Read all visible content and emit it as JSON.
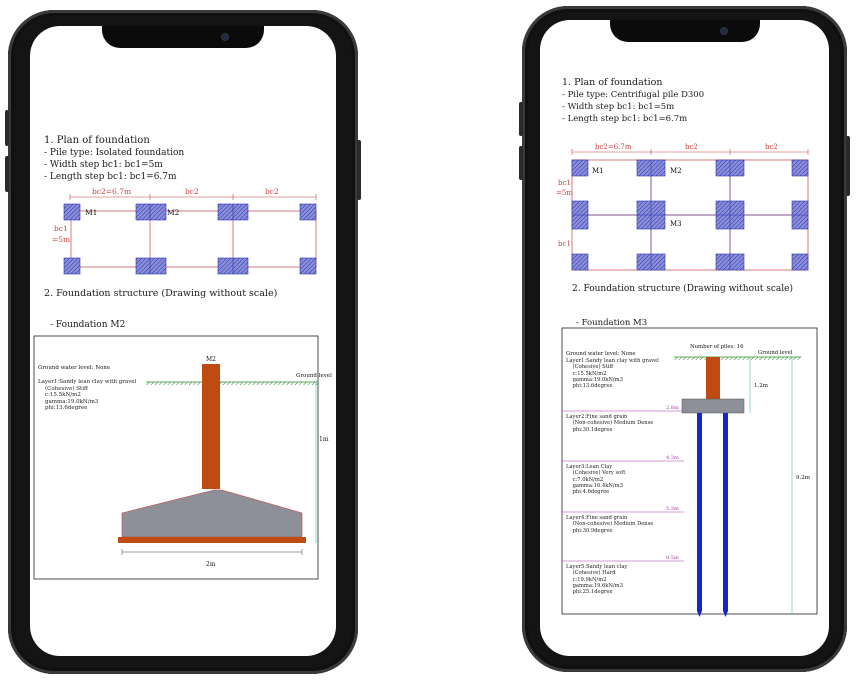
{
  "left": {
    "plan": {
      "heading": "1. Plan of foundation",
      "pile_type": "- Pile type: Isolated foundation",
      "width_step": "- Width step bc1: bc1=5m",
      "length_step": "- Length step bc1: bc1=6.7m",
      "dim_top": [
        "bc2=6.7m",
        "bc2",
        "bc2"
      ],
      "dim_side": [
        "bc1",
        "=5m"
      ],
      "marks": [
        "M1",
        "M2"
      ]
    },
    "structure_heading": "2. Foundation structure (Drawing without scale)",
    "foundation_label": "- Foundation M2",
    "section": {
      "column_label": "M2",
      "ground_water": "Ground water level: None",
      "ground_level": "Ground level",
      "layer1": "Layer1:Sandy lean clay with gravel\n    (Cohesive) Stiff\n    c:15.5kN/m2\n    gamma:19.0kN/m3\n    phi:13.6degree",
      "depth": "1m",
      "width": "2m"
    }
  },
  "right": {
    "plan": {
      "heading": "1. Plan of foundation",
      "pile_type": "- Pile type: Centrifugal pile D300",
      "width_step": "- Width step bc1: bc1=5m",
      "length_step": "- Length step bc1: bc1=6.7m",
      "dim_top": [
        "bc2=6.7m",
        "bc2",
        "bc2"
      ],
      "dim_side": [
        "bc1",
        "=5m",
        "bc1"
      ],
      "marks": [
        "M1",
        "M2",
        "M3"
      ]
    },
    "structure_heading": "2. Foundation structure (Drawing without scale)",
    "foundation_label": "- Foundation M3",
    "section": {
      "piles_count": "Number of piles: 16",
      "ground_water": "Ground water level: None",
      "ground_level": "Ground level",
      "depth_cap": "1.2m",
      "depth_pile": "9.2m",
      "layers": [
        {
          "text": "Layer1:Sandy lean clay with gravel\n    (Cohesive) Stiff\n    c:15.5kN/m2\n    gamma:19.0kN/m3\n    phi:13.6degree",
          "depth": ""
        },
        {
          "text": "Layer2:Fine sand grain\n    (Non-cohesive) Medium Dense\n    phi:30.1degree",
          "depth": "2.8m"
        },
        {
          "text": "Layer3:Lean Clay\n    (Cohesive) Very soft\n    c:7.0kN/m2\n    gamma:16.4kN/m3\n    phi:4.6degree",
          "depth": "4.3m"
        },
        {
          "text": "Layer4:Fine sand grain\n    (Non-cohesive) Medium Dense\n    phi:30.9degree",
          "depth": "5.3m"
        },
        {
          "text": "Layer5:Sandy lean clay\n    (Cohesive) Hard\n    c:19.9kN/m2\n    gamma:19.6kN/m3\n    phi:25.1degree",
          "depth": "8.5m"
        }
      ]
    }
  }
}
